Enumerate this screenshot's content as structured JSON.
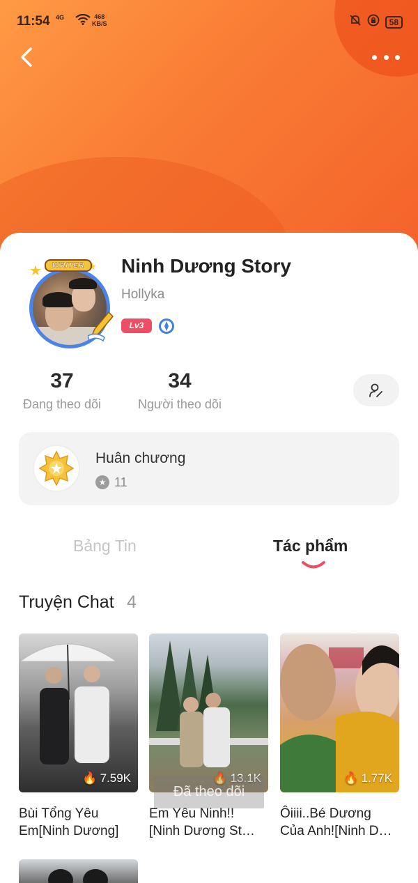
{
  "status_bar": {
    "time": "11:54",
    "network": "4G",
    "speed_value": "468",
    "speed_unit": "KB/S",
    "battery": "58"
  },
  "profile": {
    "badge_text": "WRITER",
    "name": "Ninh Dương Story",
    "handle": "Hollyka",
    "level": "Lv3"
  },
  "stats": {
    "following_count": "37",
    "following_label": "Đang theo dõi",
    "followers_count": "34",
    "followers_label": "Người theo dõi"
  },
  "medals": {
    "title": "Huân chương",
    "count": "11"
  },
  "tabs": [
    {
      "label": "Bảng Tin",
      "active": false
    },
    {
      "label": "Tác phẩm",
      "active": true
    }
  ],
  "section": {
    "title": "Truyện Chat",
    "count": "4"
  },
  "stories": [
    {
      "title": "Bùi Tổng Yêu\nEm[Ninh Dương]",
      "views": "7.59K"
    },
    {
      "title": "Em Yêu Ninh!!\n[Ninh Dương St…",
      "views": "13.1K"
    },
    {
      "title": "Ôiiii..Bé Dương\nCủa Anh![Ninh D…",
      "views": "1.77K"
    }
  ],
  "toast": "Đã theo dõi",
  "colors": {
    "hero_start": "#ff9a44",
    "hero_end": "#f4622a",
    "level_badge": "#ee4e64",
    "avatar_ring": "#4a84e8",
    "tab_indicator": "#ee4e64"
  }
}
